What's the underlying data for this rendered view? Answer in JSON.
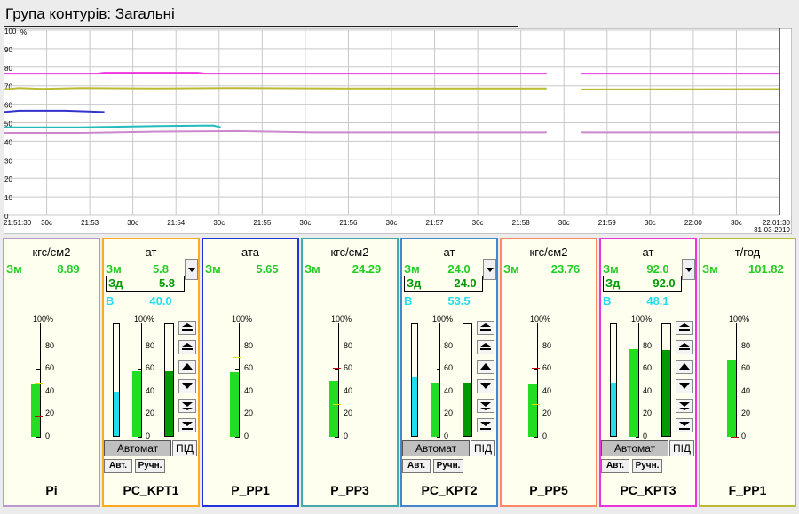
{
  "window": {
    "title": "Група контурів: Загальні"
  },
  "trend": {
    "y_ticks": [
      "100",
      "90",
      "80",
      "70",
      "60",
      "50",
      "40",
      "30",
      "20",
      "10",
      "0"
    ],
    "y_unit": "%",
    "x_labels": [
      "21:51:30",
      "30с",
      "21:53",
      "30с",
      "21:54",
      "30с",
      "21:55",
      "30с",
      "21:56",
      "30с",
      "21:57",
      "30с",
      "21:58",
      "30с",
      "21:59",
      "30с",
      "22:00",
      "30с",
      "22:01:30"
    ],
    "date": "31-03-2019",
    "gap": [
      70.5,
      74.5
    ],
    "series": [
      {
        "color": "#ee33dd",
        "points": [
          [
            0,
            76.5
          ],
          [
            12,
            76.5
          ],
          [
            13,
            77
          ],
          [
            25,
            77
          ],
          [
            26,
            76.5
          ],
          [
            70,
            76.5
          ],
          [
            74.5,
            76.5
          ],
          [
            100,
            76.5
          ]
        ]
      },
      {
        "color": "#bbbb33",
        "points": [
          [
            0,
            68
          ],
          [
            2,
            68.8
          ],
          [
            5,
            68.3
          ],
          [
            10,
            68.8
          ],
          [
            20,
            68.5
          ],
          [
            30,
            68.8
          ],
          [
            45,
            68.5
          ],
          [
            70,
            68.5
          ],
          [
            74.5,
            68
          ],
          [
            100,
            68.2
          ]
        ]
      },
      {
        "color": "#ff9900",
        "points": [
          [
            0,
            57.8
          ],
          [
            100,
            57.8
          ]
        ]
      },
      {
        "color": "#3333cc",
        "points": [
          [
            0,
            55.8
          ],
          [
            2,
            56.5
          ],
          [
            8,
            56.5
          ],
          [
            13,
            55.8
          ],
          [
            100,
            55.8
          ]
        ]
      },
      {
        "color": "#22bbbb",
        "points": [
          [
            0,
            47.5
          ],
          [
            10,
            47.5
          ],
          [
            20,
            48.2
          ],
          [
            27,
            48.5
          ],
          [
            28,
            47.5
          ],
          [
            100,
            47.5
          ]
        ]
      },
      {
        "color": "#555555",
        "points": [
          [
            0,
            47.6
          ],
          [
            100,
            47.6
          ]
        ]
      },
      {
        "color": "#ff8866",
        "points": [
          [
            0,
            46.8
          ],
          [
            100,
            46.8
          ]
        ]
      },
      {
        "color": "#cc88cc",
        "points": [
          [
            0,
            44.5
          ],
          [
            10,
            44.5
          ],
          [
            20,
            45.2
          ],
          [
            30,
            45.5
          ],
          [
            40,
            44.8
          ],
          [
            70,
            44.8
          ],
          [
            74.5,
            44.8
          ],
          [
            100,
            44.8
          ]
        ]
      }
    ]
  },
  "labels": {
    "pv": "Зм",
    "sp": "Зд",
    "out": "В",
    "pct": "100",
    "pct_unit": "%",
    "mode": "Автомат",
    "pid": "ПІД",
    "auto": "Авт.",
    "manual": "Ручн."
  },
  "scale_ticks": [
    "80",
    "60",
    "40",
    "20",
    "0"
  ],
  "colors": {
    "pv_fill": "#22dd22",
    "sp_fill": "#009900",
    "out_fill": "#22ddee",
    "background": "#fffff0"
  },
  "panels": [
    {
      "border": "#bb99cc",
      "unit": "кгс/см2",
      "pv": "8.89",
      "pv_pct": 0.47,
      "hi": 0.8,
      "mid": 0.48,
      "lo": 0.19,
      "name": "Pi",
      "controller": false
    },
    {
      "border": "#ffaa22",
      "unit": "ат",
      "pv": "5.8",
      "sp": "5.8",
      "out": "40.0",
      "pv_pct": 0.58,
      "sp_pct": 0.58,
      "out_pct": 0.4,
      "name": "PC_KPT1",
      "controller": true
    },
    {
      "border": "#2233dd",
      "unit": "ата",
      "pv": "5.65",
      "pv_pct": 0.57,
      "hi": 0.8,
      "mid": 0.7,
      "lo": null,
      "name": "P_PP1",
      "controller": false
    },
    {
      "border": "#44aaaa",
      "unit": "кгс/см2",
      "pv": "24.29",
      "pv_pct": 0.49,
      "hi": 0.61,
      "mid": 0.29,
      "lo": null,
      "name": "P_PP3",
      "controller": false
    },
    {
      "border": "#4488cc",
      "unit": "ат",
      "pv": "24.0",
      "sp": "24.0",
      "out": "53.5",
      "pv_pct": 0.48,
      "sp_pct": 0.48,
      "out_pct": 0.53,
      "name": "PC_KPT2",
      "controller": true
    },
    {
      "border": "#ff8866",
      "unit": "кгс/см2",
      "pv": "23.76",
      "pv_pct": 0.47,
      "hi": 0.61,
      "mid": 0.29,
      "lo": null,
      "name": "P_PP5",
      "controller": false
    },
    {
      "border": "#ee33dd",
      "unit": "ат",
      "pv": "92.0",
      "sp": "92.0",
      "out": "48.1",
      "pv_pct": 0.77,
      "sp_pct": 0.77,
      "out_pct": 0.48,
      "name": "PC_KPT3",
      "controller": true
    },
    {
      "border": "#bbbb33",
      "unit": "т/год",
      "pv": "101.82",
      "pv_pct": 0.68,
      "hi": null,
      "mid": null,
      "lo": 0.0,
      "name": "F_PP1",
      "controller": false
    }
  ]
}
